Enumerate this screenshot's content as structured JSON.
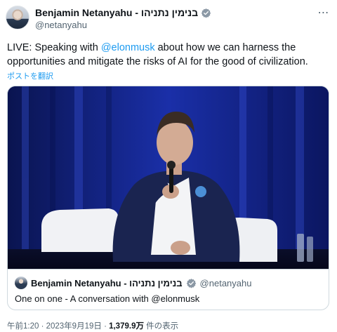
{
  "author": {
    "display_name": "Benjamin Netanyahu - בנימין נתניהו",
    "handle": "@netanyahu",
    "verified_icon": "verified-badge-icon",
    "badge_color": "#8b98a5"
  },
  "tweet": {
    "text_before": "LIVE: Speaking with ",
    "mention": "@elonmusk",
    "text_after": " about how we can harness the opportunities and mitigate the risks of AI for the good of civilization.",
    "translate_label": "ポストを翻訳"
  },
  "quoted": {
    "display_name": "Benjamin Netanyahu - בנימין נתניהו",
    "handle": "@netanyahu",
    "text": "One on one - A conversation with @elonmusk"
  },
  "meta": {
    "time_date": "午前1:20 · 2023年9月19日 · ",
    "views_count": "1,379.9万",
    "views_label": " 件の表示"
  },
  "colors": {
    "link": "#1d9bf0",
    "secondary": "#536471",
    "stage_blue": "#14238f"
  }
}
